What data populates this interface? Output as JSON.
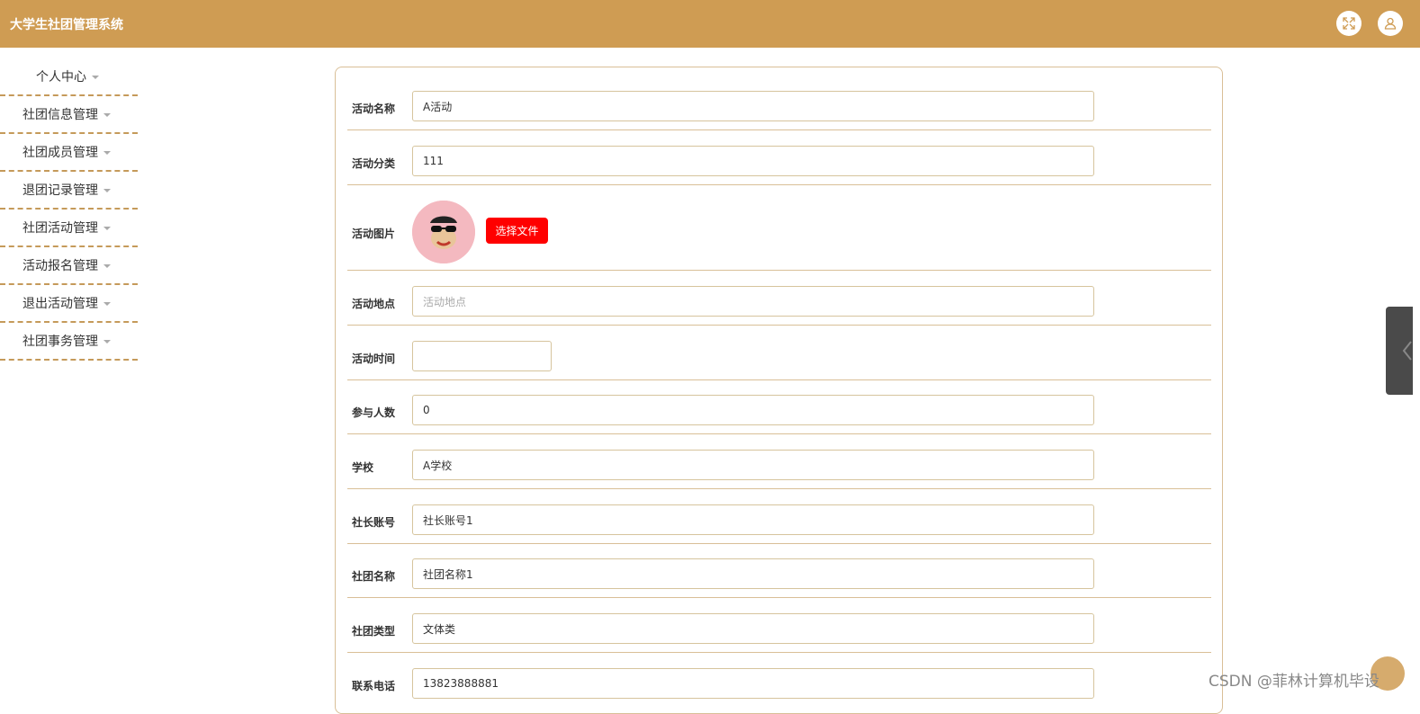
{
  "app": {
    "title": "大学生社团管理系统"
  },
  "header": {
    "icons": [
      "fullscreen-icon",
      "user-icon"
    ]
  },
  "sidebar": {
    "items": [
      {
        "label": "个人中心"
      },
      {
        "label": "社团信息管理"
      },
      {
        "label": "社团成员管理"
      },
      {
        "label": "退团记录管理"
      },
      {
        "label": "社团活动管理"
      },
      {
        "label": "活动报名管理"
      },
      {
        "label": "退出活动管理"
      },
      {
        "label": "社团事务管理"
      }
    ]
  },
  "form": {
    "activity_name": {
      "label": "活动名称",
      "value": "A活动"
    },
    "activity_category": {
      "label": "活动分类",
      "value": "111"
    },
    "activity_image": {
      "label": "活动图片",
      "button": "选择文件"
    },
    "activity_location": {
      "label": "活动地点",
      "placeholder": "活动地点"
    },
    "activity_time": {
      "label": "活动时间",
      "value": ""
    },
    "participants": {
      "label": "参与人数",
      "value": "0"
    },
    "school": {
      "label": "学校",
      "value": "A学校"
    },
    "president_account": {
      "label": "社长账号",
      "value": "社长账号1"
    },
    "club_name": {
      "label": "社团名称",
      "value": "社团名称1"
    },
    "club_type": {
      "label": "社团类型",
      "value": "文体类"
    },
    "phone": {
      "label": "联系电话",
      "value": "13823888881"
    }
  },
  "watermark": {
    "text": "CSDN @菲林计算机毕设"
  },
  "colors": {
    "accent": "#cf9c53",
    "button": "#ff0000",
    "border": "#d9bf97"
  }
}
